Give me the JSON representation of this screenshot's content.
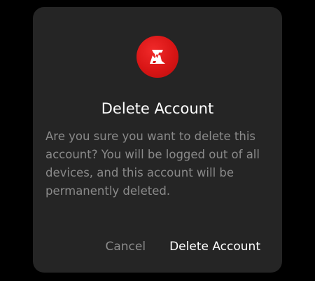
{
  "dialog": {
    "icon": "brand-logo-icon",
    "title": "Delete Account",
    "message": "Are you sure you want to delete this account? You will be logged out of all devices, and this account will be permanently deleted.",
    "cancel_label": "Cancel",
    "confirm_label": "Delete Account"
  },
  "colors": {
    "background": "#000000",
    "dialog": "#252525",
    "accent": "#e01b1b",
    "title_text": "#ffffff",
    "body_text": "#8a8a8a",
    "cancel_text": "#8c8c8c",
    "confirm_text": "#ffffff"
  }
}
